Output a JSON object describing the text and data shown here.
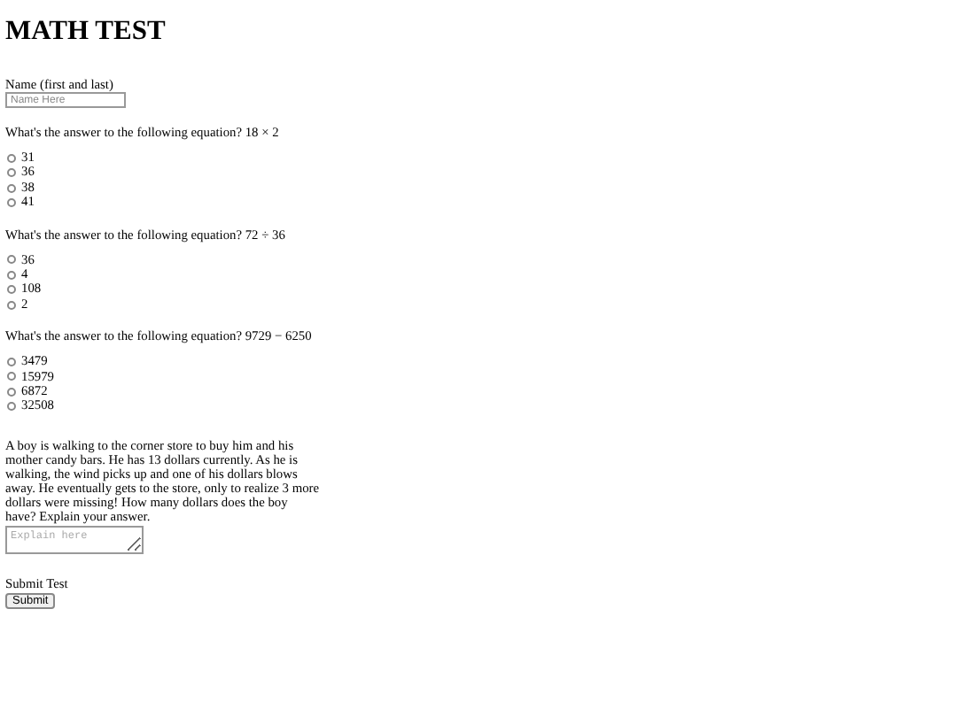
{
  "title": "MATH TEST",
  "name_field": {
    "label": "Name (first and last)",
    "placeholder": "Name Here"
  },
  "questions": [
    {
      "text": "What's the answer to the following equation? 18 × 2",
      "options": [
        {
          "label": "31",
          "selected": false
        },
        {
          "label": "36",
          "selected": false
        },
        {
          "label": "38",
          "selected": false
        },
        {
          "label": "41",
          "selected": false
        }
      ]
    },
    {
      "text": "What's the answer to the following equation? 72 ÷ 36",
      "options": [
        {
          "label": "36",
          "selected": false
        },
        {
          "label": "4",
          "selected": false
        },
        {
          "label": "108",
          "selected": false
        },
        {
          "label": "2",
          "selected": false
        }
      ]
    },
    {
      "text": "What's the answer to the following equation? 9729 − 6250",
      "options": [
        {
          "label": "3479",
          "selected": false
        },
        {
          "label": "15979",
          "selected": false
        },
        {
          "label": "6872",
          "selected": false
        },
        {
          "label": "32508",
          "selected": false
        }
      ]
    }
  ],
  "word_problem": {
    "text": "A boy is walking to the corner store to buy him and his mother candy bars. He has 13 dollars currently. As he is walking, the wind picks up and one of his dollars blows away. He eventually gets to the store, only to realize 3 more dollars were missing! How many dollars does the boy have? Explain your answer.",
    "placeholder": "Explain here"
  },
  "submit": {
    "label": "Submit Test",
    "button": "Submit"
  }
}
